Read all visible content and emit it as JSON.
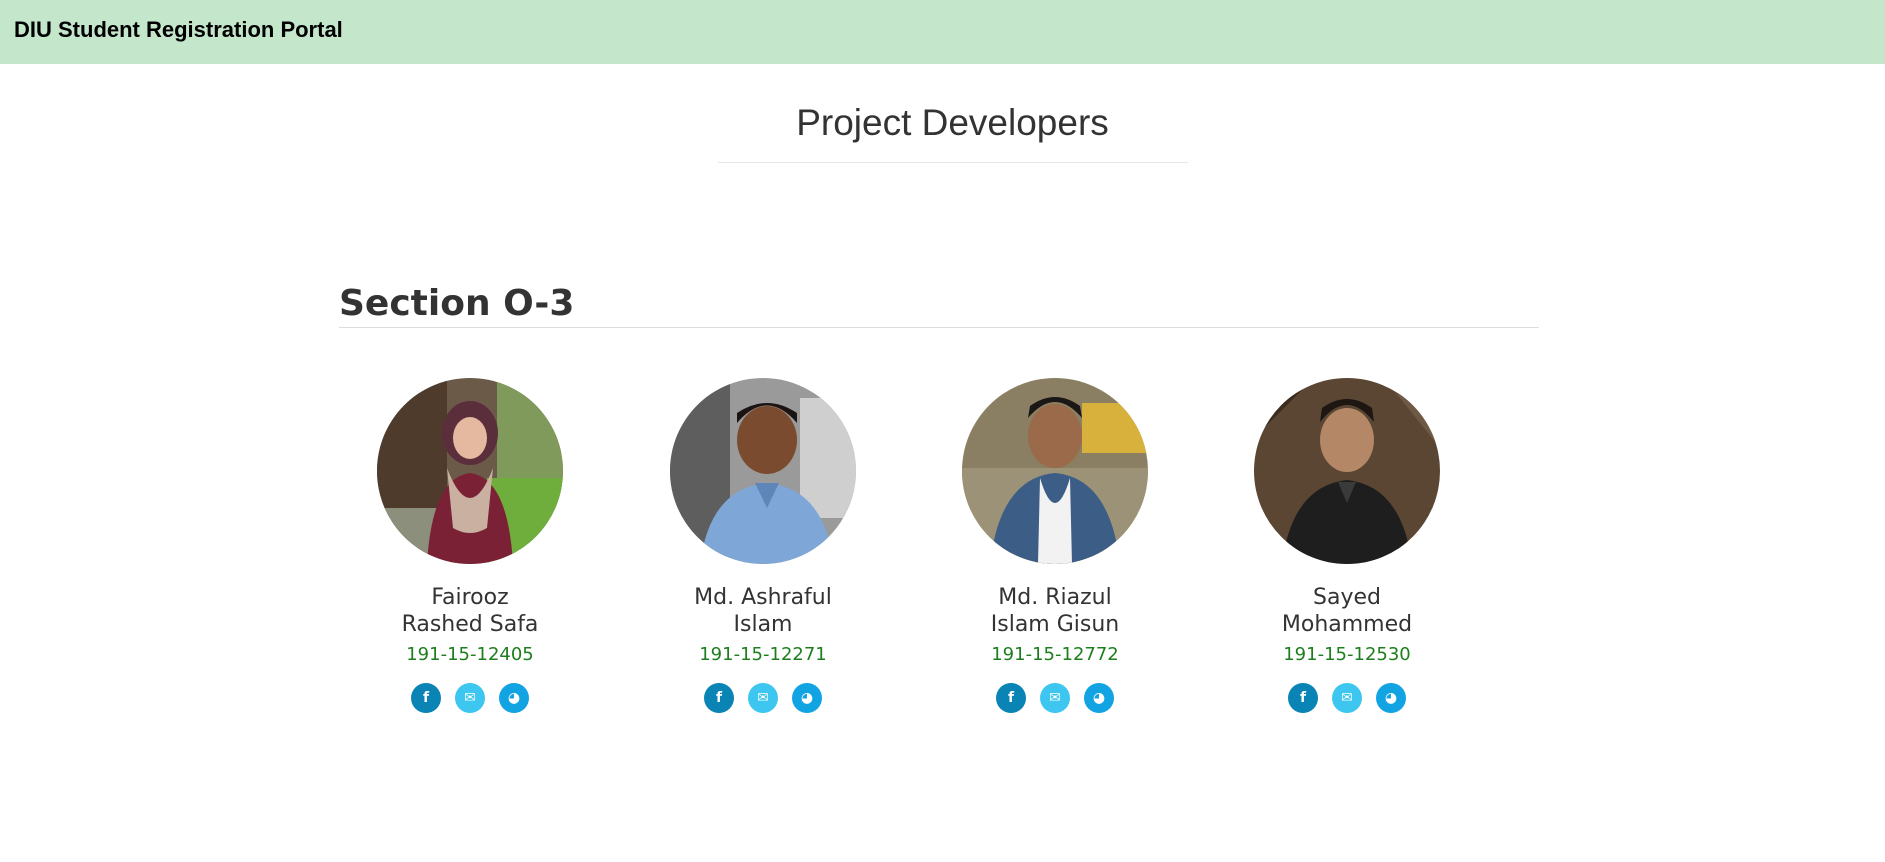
{
  "header": {
    "brand": "DIU Student Registration Portal",
    "background": "#c4e6cb"
  },
  "page": {
    "title": "Project Developers"
  },
  "section": {
    "heading": "Section O-3"
  },
  "developers": [
    {
      "name": "Fairooz Rashed Safa",
      "id": "191-15-12405"
    },
    {
      "name": "Md. Ashraful Islam",
      "id": "191-15-12271"
    },
    {
      "name": "Md. Riazul Islam Gisun",
      "id": "191-15-12772"
    },
    {
      "name": "Sayed Mohammed",
      "id": "191-15-12530"
    }
  ],
  "socials": [
    {
      "icon": "facebook-icon",
      "glyph": "f",
      "color": "#0a84b5"
    },
    {
      "icon": "mail-icon",
      "glyph": "✉",
      "color": "#3dc6ef"
    },
    {
      "icon": "globe-icon",
      "glyph": "◕",
      "color": "#12a3e3"
    }
  ],
  "colors": {
    "id_text": "#1d7e1d"
  }
}
